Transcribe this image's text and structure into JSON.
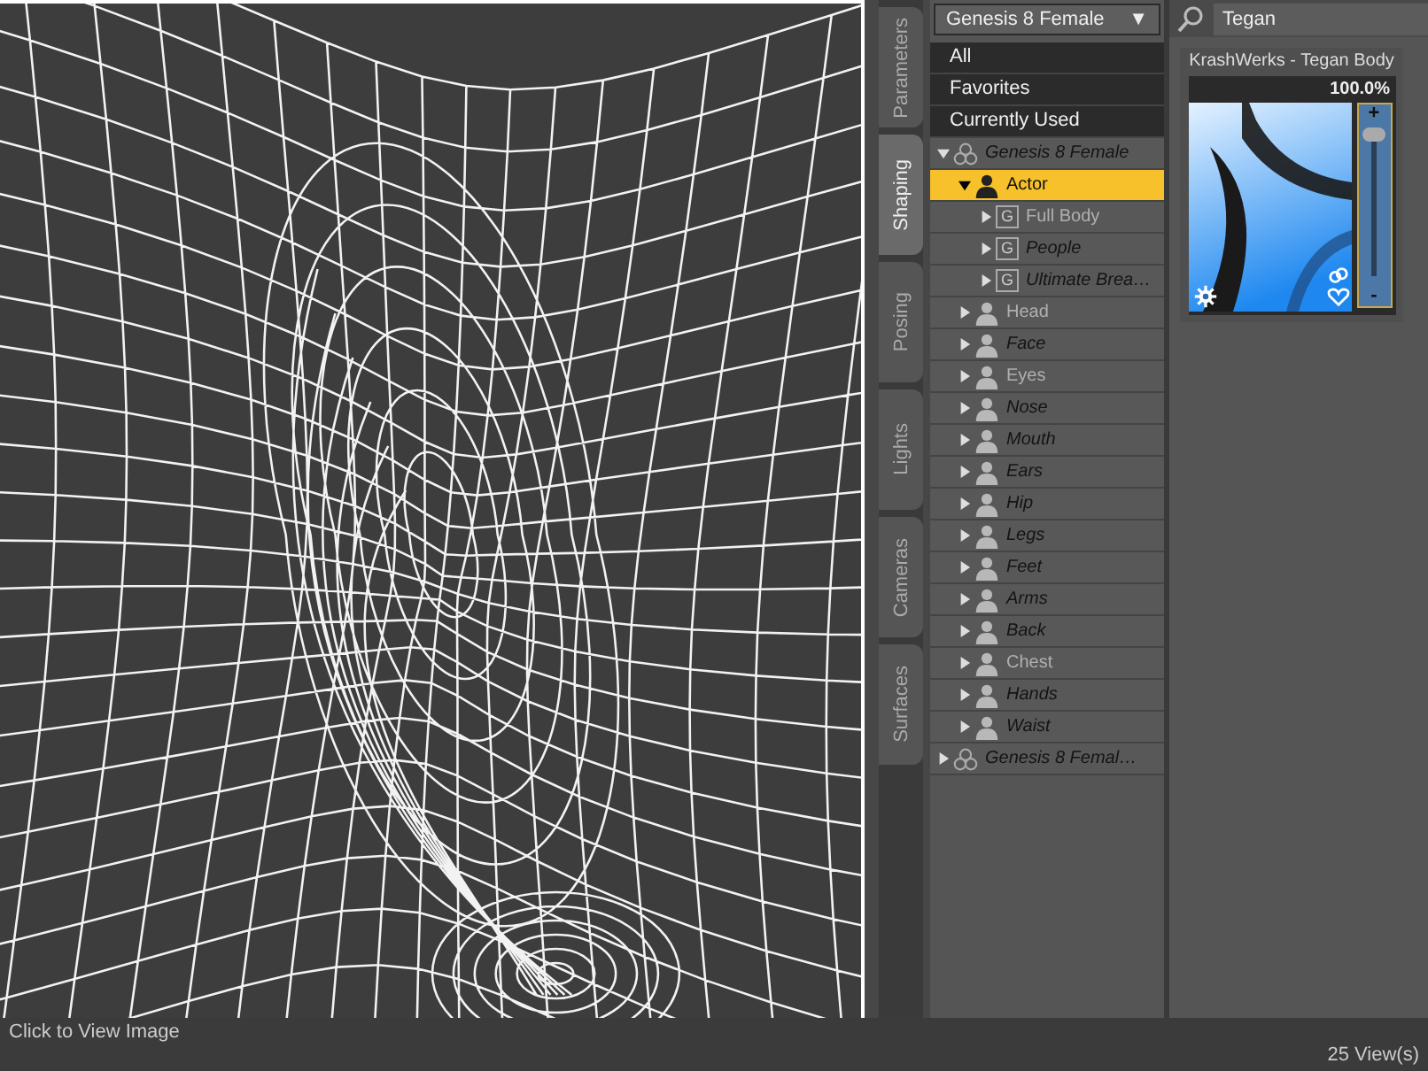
{
  "viewport": {
    "caption": "Click to View Image"
  },
  "side_tabs": [
    {
      "label": "Parameters",
      "selected": false
    },
    {
      "label": "Shaping",
      "selected": true
    },
    {
      "label": "Posing",
      "selected": false
    },
    {
      "label": "Lights",
      "selected": false
    },
    {
      "label": "Cameras",
      "selected": false
    },
    {
      "label": "Surfaces",
      "selected": false
    }
  ],
  "figure_dropdown": {
    "value": "Genesis 8 Female",
    "caret": "▼"
  },
  "categories": [
    {
      "label": "All"
    },
    {
      "label": "Favorites"
    },
    {
      "label": "Currently Used"
    }
  ],
  "tree": [
    {
      "label": "Genesis 8 Female",
      "kind": "figure",
      "dimmed": true,
      "expanded": true,
      "selected": false,
      "children": [
        {
          "label": "Actor",
          "kind": "actor",
          "dimmed": false,
          "expanded": true,
          "selected": true,
          "children": [
            {
              "label": "Full Body",
              "kind": "group",
              "badge": "G",
              "dimmed": false,
              "expanded": false,
              "selected": false
            },
            {
              "label": "People",
              "kind": "group",
              "badge": "G",
              "dimmed": true,
              "expanded": false,
              "selected": false
            },
            {
              "label": "Ultimate Brea…",
              "kind": "group",
              "badge": "G",
              "dimmed": true,
              "expanded": false,
              "selected": false
            }
          ]
        },
        {
          "label": "Head",
          "kind": "person",
          "dimmed": false,
          "expanded": false,
          "selected": false
        },
        {
          "label": "Face",
          "kind": "person",
          "dimmed": true,
          "expanded": false,
          "selected": false
        },
        {
          "label": "Eyes",
          "kind": "person",
          "dimmed": false,
          "expanded": false,
          "selected": false
        },
        {
          "label": "Nose",
          "kind": "person",
          "dimmed": true,
          "expanded": false,
          "selected": false
        },
        {
          "label": "Mouth",
          "kind": "person",
          "dimmed": true,
          "expanded": false,
          "selected": false
        },
        {
          "label": "Ears",
          "kind": "person",
          "dimmed": true,
          "expanded": false,
          "selected": false
        },
        {
          "label": "Hip",
          "kind": "person",
          "dimmed": true,
          "expanded": false,
          "selected": false
        },
        {
          "label": "Legs",
          "kind": "person",
          "dimmed": true,
          "expanded": false,
          "selected": false
        },
        {
          "label": "Feet",
          "kind": "person",
          "dimmed": true,
          "expanded": false,
          "selected": false
        },
        {
          "label": "Arms",
          "kind": "person",
          "dimmed": true,
          "expanded": false,
          "selected": false
        },
        {
          "label": "Back",
          "kind": "person",
          "dimmed": true,
          "expanded": false,
          "selected": false
        },
        {
          "label": "Chest",
          "kind": "person",
          "dimmed": false,
          "expanded": false,
          "selected": false
        },
        {
          "label": "Hands",
          "kind": "person",
          "dimmed": true,
          "expanded": false,
          "selected": false
        },
        {
          "label": "Waist",
          "kind": "person",
          "dimmed": true,
          "expanded": false,
          "selected": false
        }
      ]
    },
    {
      "label": "Genesis 8 Femal…",
      "kind": "figure",
      "dimmed": true,
      "expanded": false,
      "selected": false
    }
  ],
  "search": {
    "value": "Tegan"
  },
  "morph_card": {
    "title": "KrashWerks - Tegan Body",
    "reading": "100.0%",
    "plus": "+",
    "minus": "-",
    "level": 1.0
  },
  "status_bar": {
    "views": "25 View(s)"
  }
}
